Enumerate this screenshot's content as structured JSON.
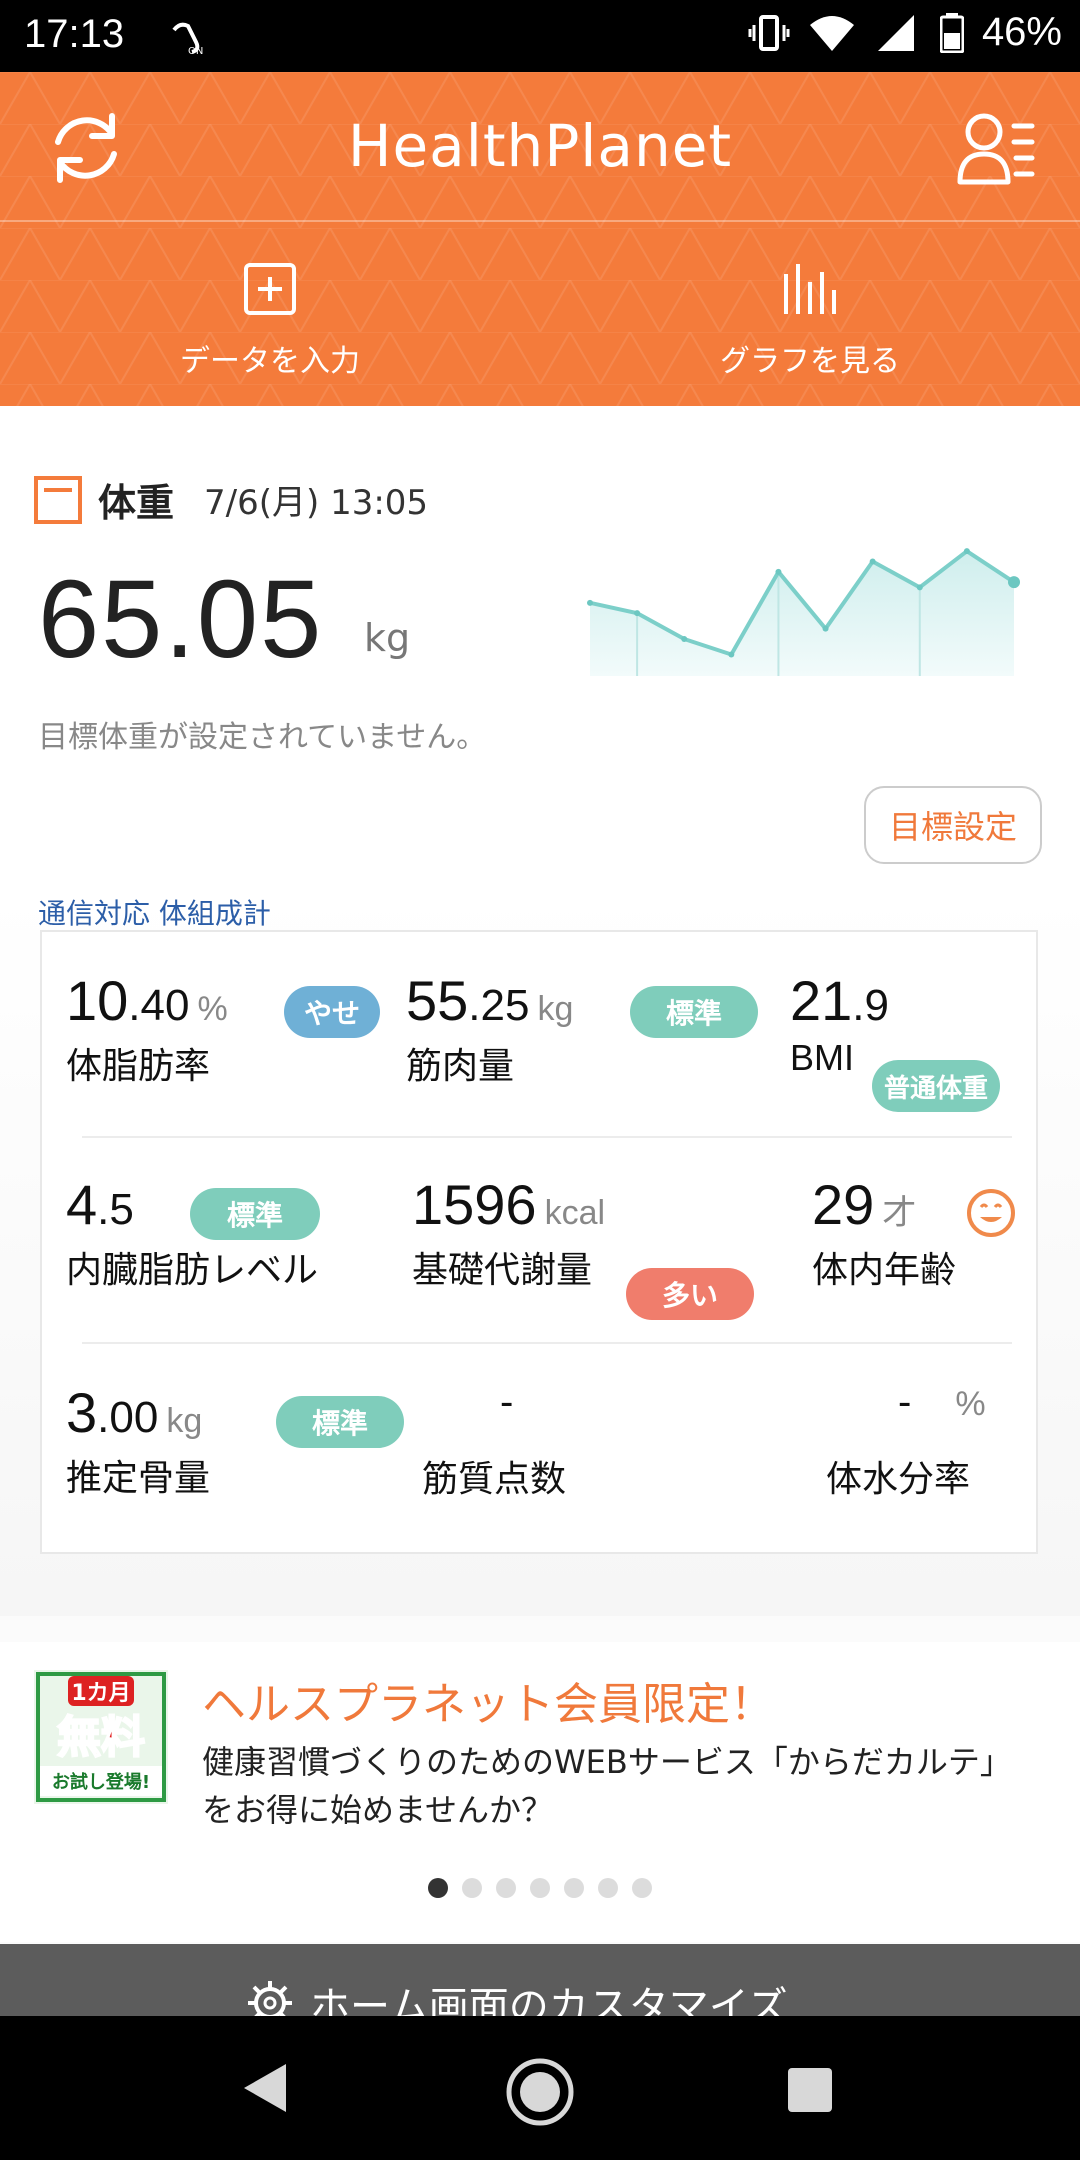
{
  "status_bar": {
    "time": "17:13",
    "battery": "46%"
  },
  "header": {
    "title": "HealthPlanet",
    "action_input": "データを入力",
    "action_graph": "グラフを見る"
  },
  "weight": {
    "title": "体重",
    "date": "7/6(月) 13:05",
    "value": "65.05",
    "unit": "kg",
    "note": "目標体重が設定されていません。",
    "goal_button": "目標設定",
    "device_label": "通信対応 体組成計",
    "trend": [
      65.3,
      65.1,
      64.6,
      64.3,
      65.9,
      64.8,
      66.1,
      65.6,
      66.3,
      65.7
    ]
  },
  "metrics": {
    "body_fat": {
      "int": "10",
      "dec": ".40",
      "unit": "%",
      "badge": "やせ",
      "name": "体脂肪率"
    },
    "muscle": {
      "int": "55",
      "dec": ".25",
      "unit": "kg",
      "badge": "標準",
      "name": "筋肉量"
    },
    "bmi": {
      "int": "21",
      "dec": ".9",
      "name": "BMI",
      "badge": "普通体重"
    },
    "visceral": {
      "int": "4",
      "dec": ".5",
      "badge": "標準",
      "name": "内臓脂肪レベル"
    },
    "bmr": {
      "value": "1596",
      "unit": "kcal",
      "badge": "多い",
      "name": "基礎代謝量"
    },
    "body_age": {
      "value": "29",
      "unit": "才",
      "name": "体内年齢"
    },
    "bone": {
      "int": "3",
      "dec": ".00",
      "unit": "kg",
      "badge": "標準",
      "name": "推定骨量"
    },
    "muscle_score": {
      "value": "-",
      "name": "筋質点数"
    },
    "water": {
      "value": "-",
      "unit": "%",
      "name": "体水分率"
    }
  },
  "promo": {
    "thumb_line1": "1カ月",
    "thumb_line2": "無料",
    "thumb_line3": "お試し登場!",
    "title": "ヘルスプラネット会員限定！",
    "text": "健康習慣づくりのためのWEBサービス「からだカルテ」をお得に始めませんか？"
  },
  "customize_label": "ホーム画面のカスタマイズ"
}
